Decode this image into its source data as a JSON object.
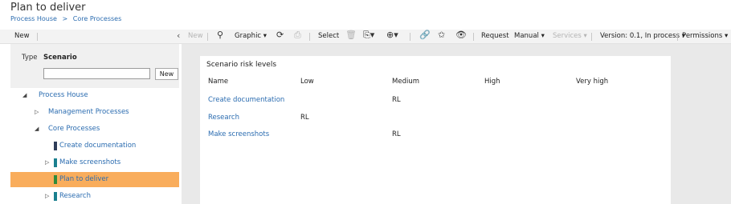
{
  "header": {
    "title": "Plan to deliver",
    "breadcrumb": [
      "Process House",
      ">",
      "Core Processes"
    ]
  },
  "left_toolbar": {
    "new_label": "New",
    "collapse_icon": "chevron-left-icon"
  },
  "left_panel": {
    "type_label": "Type",
    "type_value": "Scenario",
    "search_placeholder": "",
    "new_button": "New"
  },
  "tree": {
    "items": [
      {
        "label": "Process House",
        "toggle": "◢",
        "bar_color": ""
      },
      {
        "label": "Management Processes",
        "toggle": "▷",
        "bar_color": ""
      },
      {
        "label": "Core Processes",
        "toggle": "◢",
        "bar_color": ""
      },
      {
        "label": "Create documentation",
        "toggle": "",
        "bar_color": "#2f3d59"
      },
      {
        "label": "Make screenshots",
        "toggle": "▷",
        "bar_color": "#1a7f8f"
      },
      {
        "label": "Plan to deliver",
        "toggle": "",
        "bar_color": "#2e8b3a",
        "selected": true
      },
      {
        "label": "Research",
        "toggle": "▷",
        "bar_color": "#1a7f8f"
      }
    ]
  },
  "main_toolbar": {
    "new_label": "New",
    "graphic_label": "Graphic ▾",
    "select_label": "Select",
    "request_label": "Request",
    "manual_label": "Manual ▾",
    "services_label": "Services ▾",
    "version_label": "Version: 0.1, In process ▾",
    "permissions_label": "Permissions ▾",
    "icons": {
      "search": "⚲",
      "refresh": "⟳",
      "print": "⎙",
      "delete": "🗑",
      "copy": "⎘▾",
      "add": "⊕▾",
      "link": "🔗",
      "star": "✩",
      "eye": "👁"
    }
  },
  "risk_table": {
    "title": "Scenario risk levels",
    "columns": [
      "Name",
      "Low",
      "Medium",
      "High",
      "Very high"
    ],
    "rows": [
      {
        "name": "Create documentation",
        "low": "",
        "medium": "RL",
        "high": "",
        "very_high": ""
      },
      {
        "name": "Research",
        "low": "RL",
        "medium": "",
        "high": "",
        "very_high": ""
      },
      {
        "name": "Make screenshots",
        "low": "",
        "medium": "RL",
        "high": "",
        "very_high": ""
      }
    ]
  },
  "colors": {
    "selection": "#f9ad5c",
    "link": "#2b6cb0",
    "panel_bg": "#f0f0f0",
    "content_bg": "#e9e9e9"
  }
}
